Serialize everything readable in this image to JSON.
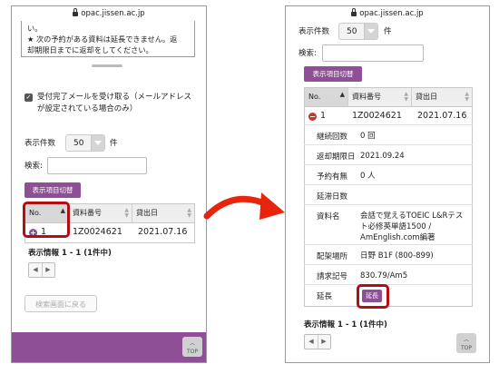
{
  "url": "opac.jissen.ac.jp",
  "left": {
    "notice_line1": "い。",
    "notice_line2": "★ 次の予約がある資料は延長できません。返",
    "notice_line3": "却期限日までに返却をしてください。",
    "checkbox_label_line1": "受付完了メールを受け取る（メールアドレス",
    "checkbox_label_line2": "が設定されている場合のみ）",
    "display_count_label": "表示件数",
    "display_count_value": "50",
    "display_count_unit": "件",
    "search_label": "検索:",
    "toggle_button": "表示項目切替",
    "table": {
      "headers": [
        "No.",
        "資料番号",
        "貸出日"
      ],
      "row": {
        "no": "1",
        "material_id": "1Z0024621",
        "loan_date": "2021.07.16"
      }
    },
    "display_info": "表示情報 1 - 1 (1件中)",
    "back_button": "検索画面に戻る",
    "top_button": "TOP"
  },
  "right": {
    "display_count_label": "表示件数",
    "display_count_value": "50",
    "display_count_unit": "件",
    "search_label": "検索:",
    "toggle_button": "表示項目切替",
    "table": {
      "headers": [
        "No.",
        "資料番号",
        "貸出日"
      ],
      "row": {
        "no": "1",
        "material_id": "1Z0024621",
        "loan_date": "2021.07.16"
      }
    },
    "details": [
      {
        "label": "継続回数",
        "value": "0 回"
      },
      {
        "label": "返却期限日",
        "value": "2021.09.24"
      },
      {
        "label": "予約有無",
        "value": "0 人"
      },
      {
        "label": "延滞日数",
        "value": ""
      },
      {
        "label": "資料名",
        "value": "会話で覚えるTOEIC L&Rテスト必修英単語1500 / AmEnglish.com編著"
      },
      {
        "label": "配架場所",
        "value": "日野 B1F (800-899)"
      },
      {
        "label": "請求記号",
        "value": "830.79/Am5"
      },
      {
        "label": "延長",
        "value": ""
      }
    ],
    "extend_button": "延長",
    "display_info": "表示情報 1 - 1 (1件中)",
    "top_button": "TOP"
  },
  "colors": {
    "accent": "#8f4f96",
    "highlight": "#b50d14",
    "arrow": "#e8250c"
  }
}
